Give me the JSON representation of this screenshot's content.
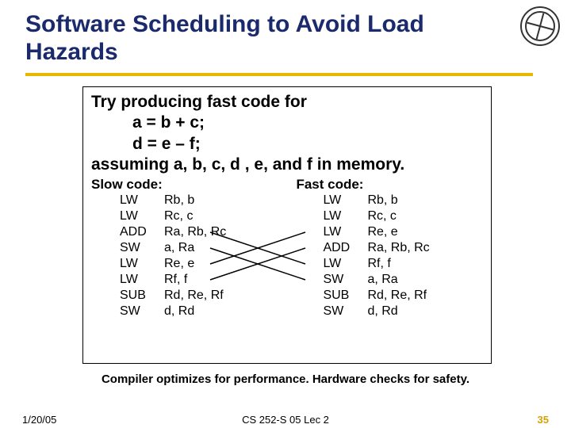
{
  "title": "Software Scheduling to Avoid Load Hazards",
  "intro": {
    "line1": "Try producing fast code for",
    "line2": "a = b + c;",
    "line3": "d = e – f;",
    "line4": "assuming a, b, c, d , e, and f in memory."
  },
  "slow": {
    "header": "Slow code:",
    "rows": [
      {
        "op": "LW",
        "arg": "Rb, b"
      },
      {
        "op": "LW",
        "arg": "Rc, c"
      },
      {
        "op": "ADD",
        "arg": "Ra, Rb, Rc"
      },
      {
        "op": "SW",
        "arg": "a, Ra"
      },
      {
        "op": "LW",
        "arg": "Re, e"
      },
      {
        "op": "LW",
        "arg": "Rf, f"
      },
      {
        "op": "SUB",
        "arg": "Rd, Re, Rf"
      },
      {
        "op": "SW",
        "arg": "d, Rd"
      }
    ]
  },
  "fast": {
    "header": "Fast code:",
    "rows": [
      {
        "op": "LW",
        "arg": "Rb, b"
      },
      {
        "op": "LW",
        "arg": "Rc, c"
      },
      {
        "op": "LW",
        "arg": "Re, e"
      },
      {
        "op": "ADD",
        "arg": "Ra, Rb, Rc"
      },
      {
        "op": "LW",
        "arg": "Rf, f"
      },
      {
        "op": "SW",
        "arg": "a, Ra"
      },
      {
        "op": "SUB",
        "arg": "Rd, Re, Rf"
      },
      {
        "op": "SW",
        "arg": "d, Rd"
      }
    ]
  },
  "bottom_note": "Compiler optimizes for performance.  Hardware checks for safety.",
  "footer": {
    "date": "1/20/05",
    "course": "CS 252-S 05 Lec 2",
    "pagenum": "35"
  }
}
